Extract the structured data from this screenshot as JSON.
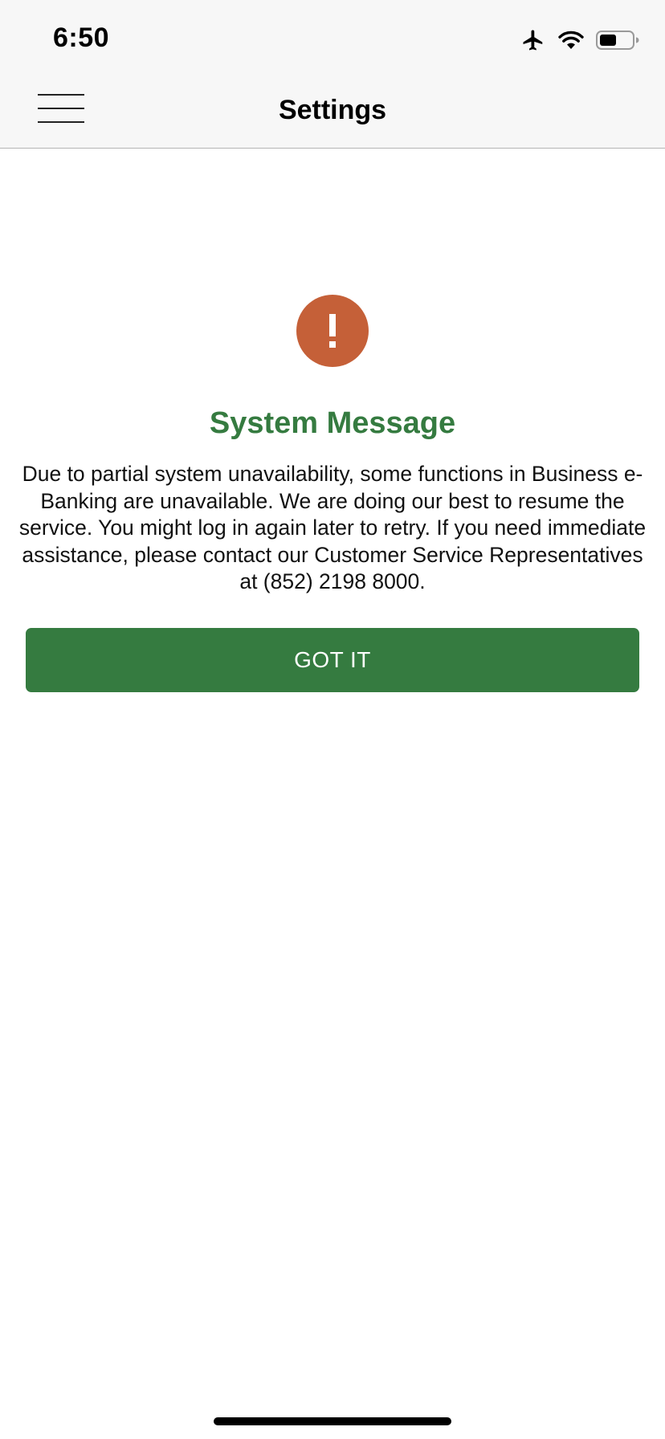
{
  "status_bar": {
    "time": "6:50",
    "icons": [
      "airplane-mode-icon",
      "wifi-icon",
      "battery-icon"
    ]
  },
  "nav": {
    "title": "Settings",
    "menu_icon": "hamburger-menu-icon"
  },
  "alert": {
    "icon": "exclamation-icon",
    "icon_color": "#c56038",
    "title": "System Message",
    "title_color": "#357b40",
    "body": "Due to partial system unavailability, some functions in Business e-Banking are unavailable. We are doing our best to resume the service. You might log in again later to retry. If you need immediate assistance, please contact our Customer Service Representatives at (852) 2198 8000.",
    "button_label": "GOT IT",
    "button_color": "#357b40"
  }
}
